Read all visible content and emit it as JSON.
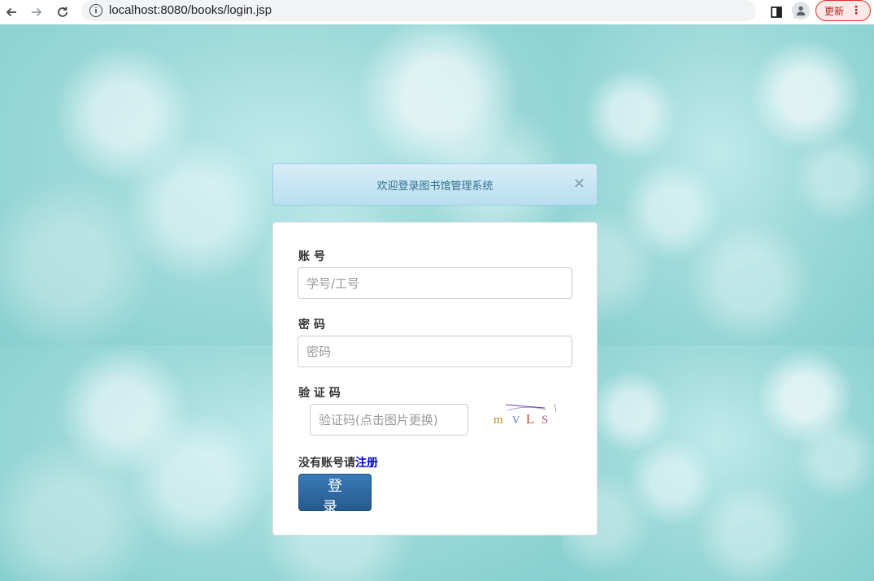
{
  "browser": {
    "url": "localhost:8080/books/login.jsp",
    "update_label": "更新"
  },
  "alert": {
    "message": "欢迎登录图书馆管理系统",
    "close_symbol": "×"
  },
  "form": {
    "account_label": "账 号",
    "account_placeholder": "学号/工号",
    "password_label": "密 码",
    "password_placeholder": "密码",
    "captcha_label": "验 证 码",
    "captcha_placeholder": "验证码(点击图片更换)",
    "captcha_text": "mVLS",
    "register_prefix": "没有账号请",
    "register_link": "注册",
    "login_button": "登 录"
  },
  "colors": {
    "alert_text": "#31708f",
    "button_bg": "#2d6ca2",
    "link": "#0000cc"
  }
}
